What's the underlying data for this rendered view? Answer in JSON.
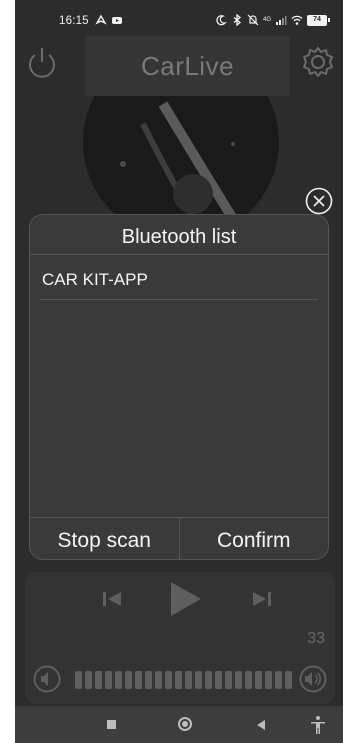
{
  "status_bar": {
    "time": "16:15",
    "battery": "74",
    "network_type": "4G",
    "left_icons": [
      "navigation-icon",
      "youtube-icon"
    ],
    "right_icons": [
      "moon-icon",
      "bluetooth-icon",
      "mute-icon",
      "signal-icon",
      "wifi-icon",
      "battery-icon"
    ]
  },
  "header": {
    "title": "CarLive",
    "left_icon": "power-icon",
    "right_icon": "gear-icon"
  },
  "dialog": {
    "title": "Bluetooth list",
    "devices": [
      "CAR KIT-APP"
    ],
    "stop_scan_label": "Stop scan",
    "confirm_label": "Confirm",
    "close_icon": "close-circle-icon"
  },
  "player": {
    "volume_value": "33",
    "controls": [
      "previous-icon",
      "play-icon",
      "next-icon"
    ],
    "volume_icons": [
      "volume-down-icon",
      "volume-up-icon"
    ]
  },
  "nav_bar": {
    "items": [
      "recents-icon",
      "home-icon",
      "back-icon",
      "accessibility-icon"
    ]
  },
  "colors": {
    "background": "#2c2c2c",
    "dialog": "#3a3a3a",
    "text": "#f5f5f5",
    "muted": "#6a6a6a"
  }
}
